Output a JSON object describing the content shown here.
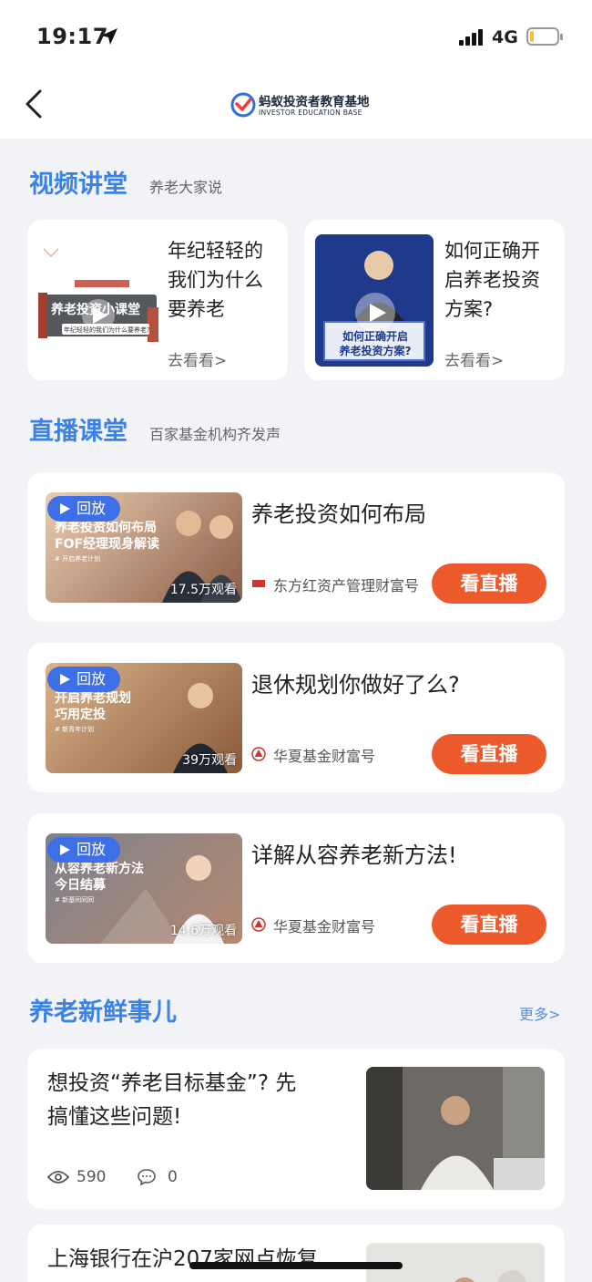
{
  "status": {
    "time": "19:17",
    "network": "4G"
  },
  "nav": {
    "title": "蚂蚁投资者教育基地",
    "subtitle": "INVESTOR EDUCATION BASE"
  },
  "video_section": {
    "title": "视频讲堂",
    "subtitle": "养老大家说",
    "cards": [
      {
        "title_lines": [
          "年纪轻轻的",
          "我们为什么",
          "要养老"
        ],
        "go": "去看看>",
        "thumb_text": "养老投资小课堂",
        "thumb_caption": "年纪轻轻的我们为什么要养老?"
      },
      {
        "title_lines": [
          "如何正确开",
          "启养老投资",
          "方案?"
        ],
        "go": "去看看>",
        "thumb_text_lines": [
          "如何正确开启",
          "养老投资方案?"
        ]
      }
    ]
  },
  "live_section": {
    "title": "直播课堂",
    "subtitle": "百家基金机构齐发声",
    "items": [
      {
        "badge": "回放",
        "views": "17.5万观看",
        "title": "养老投资如何布局",
        "publisher": "东方红资产管理财富号",
        "button": "看直播",
        "thumb_lines": [
          "养老投资如何布局",
          "FOF经理现身解读"
        ],
        "thumb_tag": "# 开启养老计划"
      },
      {
        "badge": "回放",
        "views": "39万观看",
        "title": "退休规划你做好了么?",
        "publisher": "华夏基金财富号",
        "button": "看直播",
        "thumb_lines": [
          "开启养老规划",
          "巧用定投"
        ],
        "thumb_tag": "# 新青年计划"
      },
      {
        "badge": "回放",
        "views": "14.6万观看",
        "title": "详解从容养老新方法!",
        "publisher": "华夏基金财富号",
        "button": "看直播",
        "thumb_lines": [
          "从容养老新方法",
          "今日结募"
        ],
        "thumb_tag": "# 新基同同同"
      }
    ]
  },
  "news_section": {
    "title": "养老新鲜事儿",
    "more": "更多>",
    "articles": [
      {
        "title_lines": [
          "想投资“养老目标基金”? 先",
          "搞懂这些问题!"
        ],
        "views": "590",
        "comments": "0"
      },
      {
        "title_lines": [
          "上海银行在沪207家网点恢复"
        ]
      }
    ]
  },
  "colors": {
    "accent_blue": "#3b82e6",
    "button_orange": "#ec5a2b",
    "badge_blue": "#3d6fe8"
  }
}
